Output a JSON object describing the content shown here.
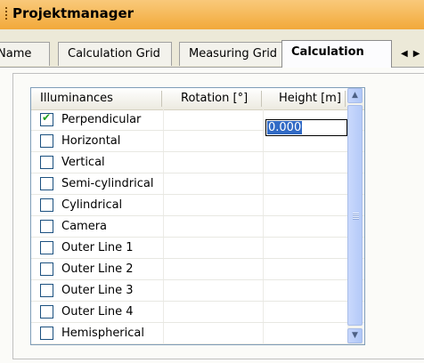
{
  "titlebar": {
    "title": "Projektmanager"
  },
  "tabs": [
    {
      "label": "Name",
      "active": false
    },
    {
      "label": "Calculation Grid",
      "active": false
    },
    {
      "label": "Measuring Grid",
      "active": false
    },
    {
      "label": "Calculation",
      "active": true
    }
  ],
  "grid": {
    "columns": [
      "Illuminances",
      "Rotation [°]",
      "Height [m]"
    ],
    "rows": [
      {
        "label": "Perpendicular",
        "checked": true
      },
      {
        "label": "Horizontal",
        "checked": false
      },
      {
        "label": "Vertical",
        "checked": false
      },
      {
        "label": "Semi-cylindrical",
        "checked": false
      },
      {
        "label": "Cylindrical",
        "checked": false
      },
      {
        "label": "Camera",
        "checked": false
      },
      {
        "label": "Outer Line 1",
        "checked": false
      },
      {
        "label": "Outer Line 2",
        "checked": false
      },
      {
        "label": "Outer Line 3",
        "checked": false
      },
      {
        "label": "Outer Line 4",
        "checked": false
      },
      {
        "label": "Hemispherical",
        "checked": false
      }
    ],
    "height_edit_value": "0.000"
  },
  "icons": {
    "tab_nav": [
      "triangle-left-icon",
      "triangle-right-icon"
    ],
    "scroll": [
      "scroll-up-icon",
      "scroll-down-icon"
    ]
  },
  "colors": {
    "titlebar": "#f2a93a",
    "selection": "#316ac5",
    "check": "#21a121"
  }
}
